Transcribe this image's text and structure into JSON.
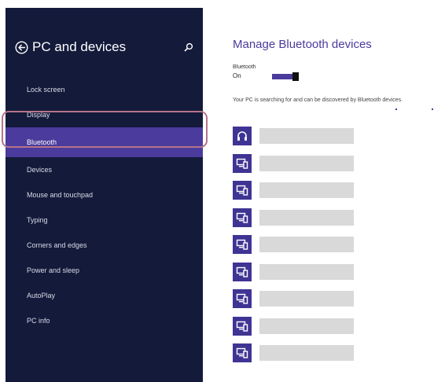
{
  "colors": {
    "sidebar_bg": "#141a3a",
    "accent": "#4a3b9c",
    "highlight_ring": "#b5748a",
    "device_tile": "#3f3494",
    "device_bar": "#d9d9d9"
  },
  "sidebar": {
    "back_icon": "back-arrow-circle-icon",
    "title": "PC and devices",
    "search_icon": "search-icon",
    "items": [
      {
        "label": "Lock screen",
        "selected": false
      },
      {
        "label": "Display",
        "selected": false
      },
      {
        "label": "Bluetooth",
        "selected": true
      },
      {
        "label": "Devices",
        "selected": false
      },
      {
        "label": "Mouse and touchpad",
        "selected": false
      },
      {
        "label": "Typing",
        "selected": false
      },
      {
        "label": "Corners and edges",
        "selected": false
      },
      {
        "label": "Power and sleep",
        "selected": false
      },
      {
        "label": "AutoPlay",
        "selected": false
      },
      {
        "label": "PC info",
        "selected": false
      }
    ]
  },
  "main": {
    "title": "Manage Bluetooth devices",
    "bluetooth_label": "Bluetooth",
    "bluetooth_state": "On",
    "bluetooth_on": true,
    "status_text": "Your PC is searching for and can be discovered by Bluetooth devices.",
    "devices": [
      {
        "icon": "headphones-icon"
      },
      {
        "icon": "computer-device-icon"
      },
      {
        "icon": "computer-device-icon"
      },
      {
        "icon": "computer-device-icon"
      },
      {
        "icon": "computer-device-icon"
      },
      {
        "icon": "computer-device-icon"
      },
      {
        "icon": "computer-device-icon"
      },
      {
        "icon": "computer-device-icon"
      },
      {
        "icon": "computer-device-icon"
      }
    ]
  }
}
